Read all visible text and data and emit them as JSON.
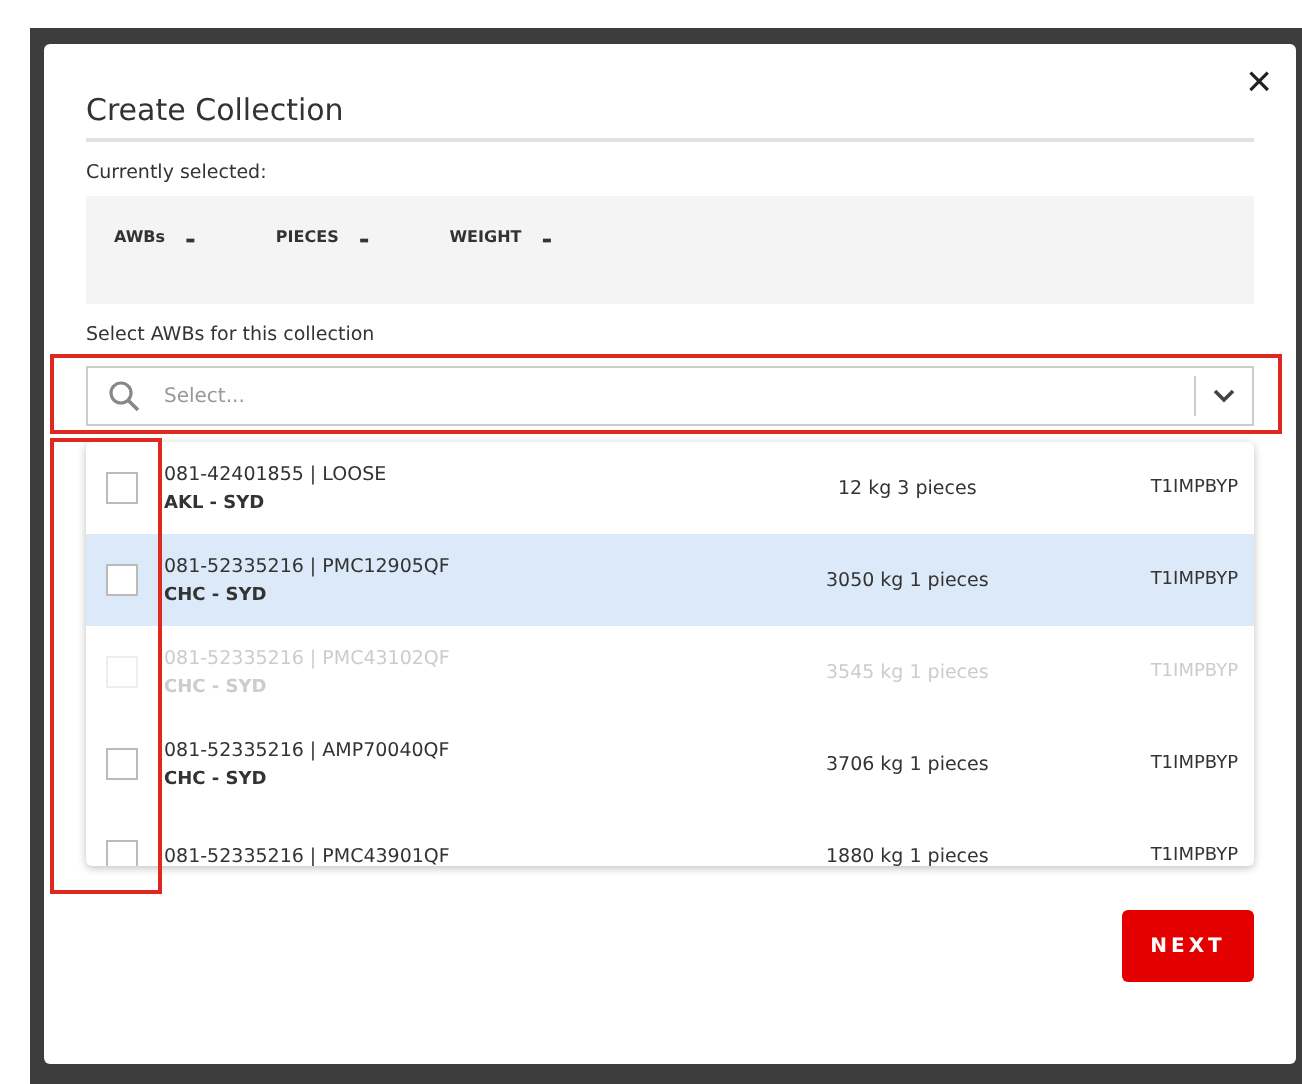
{
  "dialog": {
    "title": "Create Collection",
    "close_glyph": "×"
  },
  "summary": {
    "label": "Currently selected:",
    "stats": [
      {
        "label": "AWBs",
        "value": "-"
      },
      {
        "label": "PIECES",
        "value": "-"
      },
      {
        "label": "WEIGHT",
        "value": "-"
      }
    ]
  },
  "select": {
    "label": "Select AWBs for this collection",
    "placeholder": "Select..."
  },
  "options": [
    {
      "awb": "081-42401855 | LOOSE",
      "route": "AKL - SYD",
      "amount": "12 kg 3 pieces",
      "code": "T1IMPBYP",
      "checked": false,
      "highlighted": false,
      "disabled": false
    },
    {
      "awb": "081-52335216 | PMC12905QF",
      "route": "CHC - SYD",
      "amount": "3050 kg 1 pieces",
      "code": "T1IMPBYP",
      "checked": false,
      "highlighted": true,
      "disabled": false
    },
    {
      "awb": "081-52335216 | PMC43102QF",
      "route": "CHC - SYD",
      "amount": "3545 kg 1 pieces",
      "code": "T1IMPBYP",
      "checked": false,
      "highlighted": false,
      "disabled": true
    },
    {
      "awb": "081-52335216 | AMP70040QF",
      "route": "CHC - SYD",
      "amount": "3706 kg 1 pieces",
      "code": "T1IMPBYP",
      "checked": false,
      "highlighted": false,
      "disabled": false
    },
    {
      "awb": "081-52335216 | PMC43901QF",
      "amount": "1880 kg 1 pieces",
      "code": "T1IMPBYP",
      "checked": false,
      "highlighted": false,
      "disabled": false
    }
  ],
  "next_button": "NEXT"
}
